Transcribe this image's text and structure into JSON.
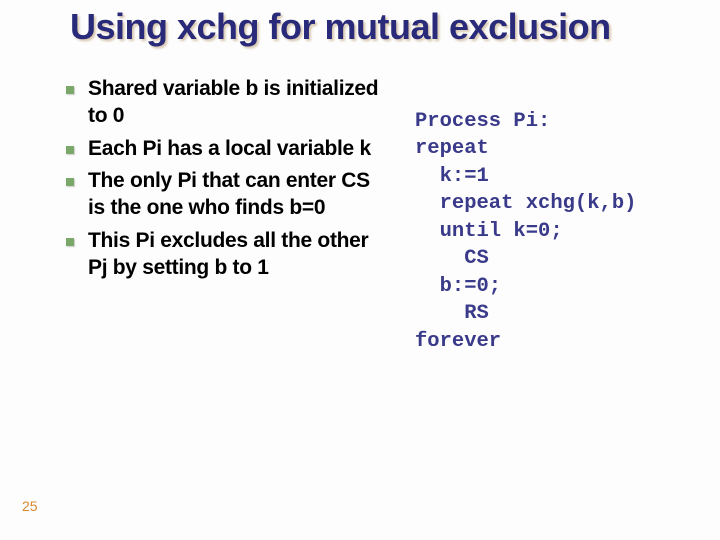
{
  "title": "Using xchg for mutual exclusion",
  "bullets": [
    "Shared variable b is initialized to 0",
    "Each Pi has a local variable k",
    "The only Pi that can enter CS is the one who finds b=0",
    "This Pi excludes all the other Pj by setting b to 1"
  ],
  "code": "Process Pi:\nrepeat\n  k:=1\n  repeat xchg(k,b)\n  until k=0;\n    CS\n  b:=0;\n    RS\nforever",
  "page_number": "25"
}
